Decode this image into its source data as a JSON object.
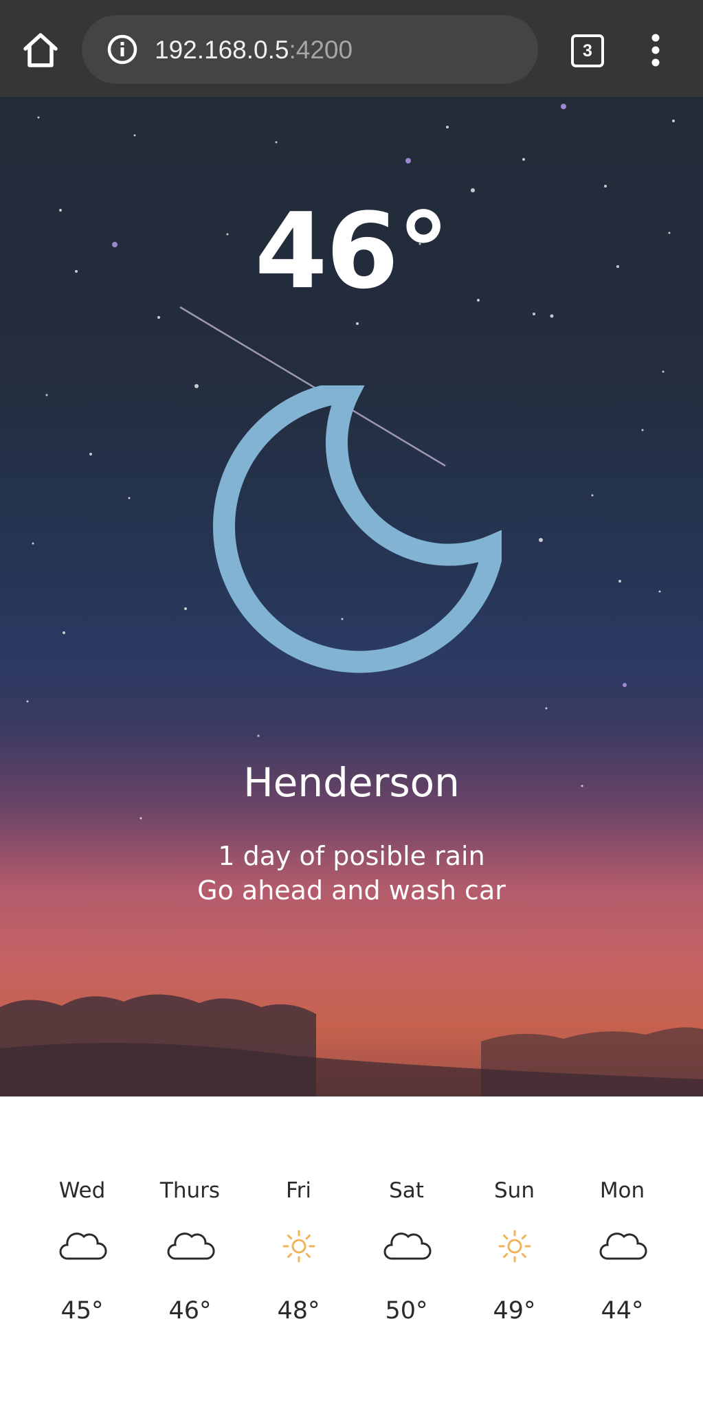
{
  "browser": {
    "url_host": "192.168.0.5",
    "url_port": ":4200",
    "tab_count": "3",
    "icons": [
      "home-icon",
      "info-icon",
      "tabs-icon",
      "more-vert-icon"
    ]
  },
  "weather": {
    "temperature": "46°",
    "condition_icon": "moon-icon",
    "city": "Henderson",
    "message_line1": "1 day of posible rain",
    "message_line2": "Go ahead and wash car",
    "moon_color": "#82b3d3"
  },
  "forecast": [
    {
      "day": "Wed",
      "icon": "cloud-icon",
      "temp": "45°"
    },
    {
      "day": "Thurs",
      "icon": "cloud-icon",
      "temp": "46°"
    },
    {
      "day": "Fri",
      "icon": "sun-icon",
      "temp": "48°"
    },
    {
      "day": "Sat",
      "icon": "cloud-icon",
      "temp": "50°"
    },
    {
      "day": "Sun",
      "icon": "sun-icon",
      "temp": "49°"
    },
    {
      "day": "Mon",
      "icon": "cloud-icon",
      "temp": "44°"
    }
  ],
  "colors": {
    "sun": "#f0b35a",
    "cloud": "#2a2a2a"
  }
}
